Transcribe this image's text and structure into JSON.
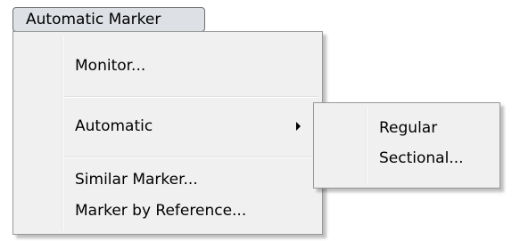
{
  "menu_button": {
    "label": "Automatic Marker"
  },
  "dropdown": {
    "items": [
      {
        "label": "Monitor..."
      },
      {
        "label": "Automatic",
        "has_submenu": true
      },
      {
        "label": "Similar Marker..."
      },
      {
        "label": "Marker by Reference..."
      }
    ]
  },
  "submenu": {
    "items": [
      {
        "label": "Regular"
      },
      {
        "label": "Sectional..."
      }
    ]
  },
  "icons": {
    "submenu_arrow": "triangle-right-icon"
  },
  "colors": {
    "menu_background": "#f0f0f0",
    "button_background": "#dde0e4",
    "border": "#979797"
  }
}
